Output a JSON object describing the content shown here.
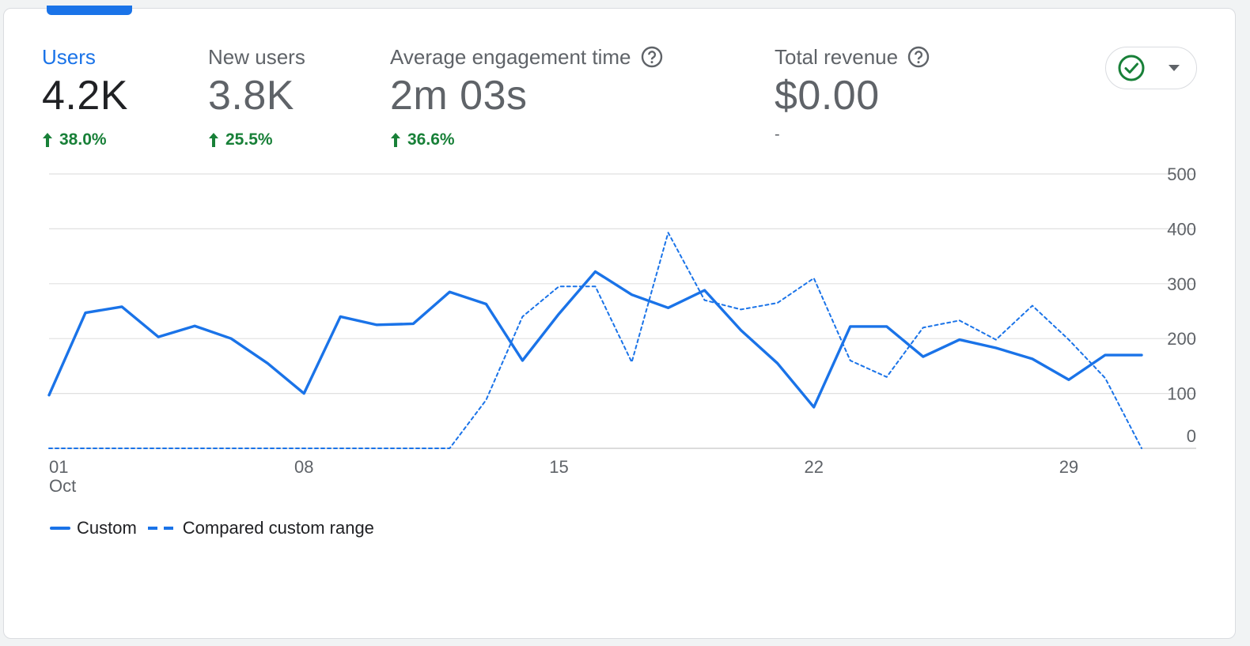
{
  "colors": {
    "accent": "#1a73e8",
    "positive": "#188038",
    "grid": "#e0e0e0",
    "muted": "#5f6368"
  },
  "metrics": [
    {
      "label": "Users",
      "value": "4.2K",
      "delta": "38.0%",
      "active": true,
      "help": false
    },
    {
      "label": "New users",
      "value": "3.8K",
      "delta": "25.5%",
      "active": false,
      "help": false
    },
    {
      "label": "Average engagement time",
      "value": "2m 03s",
      "delta": "36.6%",
      "active": false,
      "help": true
    },
    {
      "label": "Total revenue",
      "value": "$0.00",
      "delta": "-",
      "active": false,
      "help": true
    }
  ],
  "status_button": {
    "icon": "check-circle-icon",
    "caret": "caret-down-icon"
  },
  "legend": {
    "custom": "Custom",
    "compared": "Compared custom range"
  },
  "chart_data": {
    "type": "line",
    "x": [
      1,
      2,
      3,
      4,
      5,
      6,
      7,
      8,
      9,
      10,
      11,
      12,
      13,
      14,
      15,
      16,
      17,
      18,
      19,
      20,
      21,
      22,
      23,
      24,
      25,
      26,
      27,
      28,
      29,
      30,
      31
    ],
    "x_tick_labels": [
      {
        "x": 1,
        "label": "01",
        "sublabel": "Oct"
      },
      {
        "x": 8,
        "label": "08"
      },
      {
        "x": 15,
        "label": "15"
      },
      {
        "x": 22,
        "label": "22"
      },
      {
        "x": 29,
        "label": "29"
      }
    ],
    "y_ticks": [
      0,
      100,
      200,
      300,
      400,
      500
    ],
    "ylim": [
      0,
      500
    ],
    "grid": true,
    "legend_position": "bottom-left",
    "series": [
      {
        "name": "Custom",
        "style": "solid",
        "values": [
          97,
          247,
          258,
          203,
          223,
          200,
          155,
          100,
          240,
          225,
          227,
          285,
          263,
          160,
          245,
          322,
          280,
          256,
          288,
          215,
          155,
          75,
          222,
          222,
          167,
          198,
          183,
          163,
          125,
          170,
          170
        ]
      },
      {
        "name": "Compared custom range",
        "style": "dashed",
        "values": [
          0,
          0,
          0,
          0,
          0,
          0,
          0,
          0,
          0,
          0,
          0,
          0,
          88,
          240,
          295,
          295,
          157,
          393,
          270,
          253,
          265,
          310,
          160,
          130,
          220,
          233,
          198,
          260,
          198,
          128,
          0
        ]
      }
    ]
  }
}
